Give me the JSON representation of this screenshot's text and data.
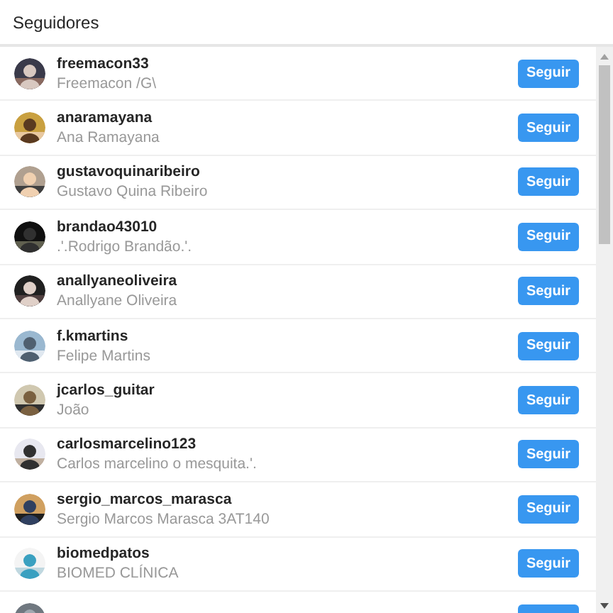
{
  "title": "Seguidores",
  "followers": [
    {
      "username": "freemacon33",
      "name": "Freemacon /G\\",
      "button": "Seguir"
    },
    {
      "username": "anaramayana",
      "name": "Ana Ramayana",
      "button": "Seguir"
    },
    {
      "username": "gustavoquinaribeiro",
      "name": "Gustavo Quina Ribeiro",
      "button": "Seguir"
    },
    {
      "username": "brandao43010",
      "name": ".'.Rodrigo Brandão.'.",
      "button": "Seguir"
    },
    {
      "username": "anallyaneoliveira",
      "name": "Anallyane Oliveira",
      "button": "Seguir"
    },
    {
      "username": "f.kmartins",
      "name": "Felipe Martins",
      "button": "Seguir"
    },
    {
      "username": "jcarlos_guitar",
      "name": "João",
      "button": "Seguir"
    },
    {
      "username": "carlosmarcelino123",
      "name": "Carlos marcelino o mesquita.'.",
      "button": "Seguir"
    },
    {
      "username": "sergio_marcos_marasca",
      "name": "Sergio Marcos Marasca 3AT140",
      "button": "Seguir"
    },
    {
      "username": "biomedpatos",
      "name": "BIOMED CLÍNICA",
      "button": "Seguir"
    }
  ]
}
